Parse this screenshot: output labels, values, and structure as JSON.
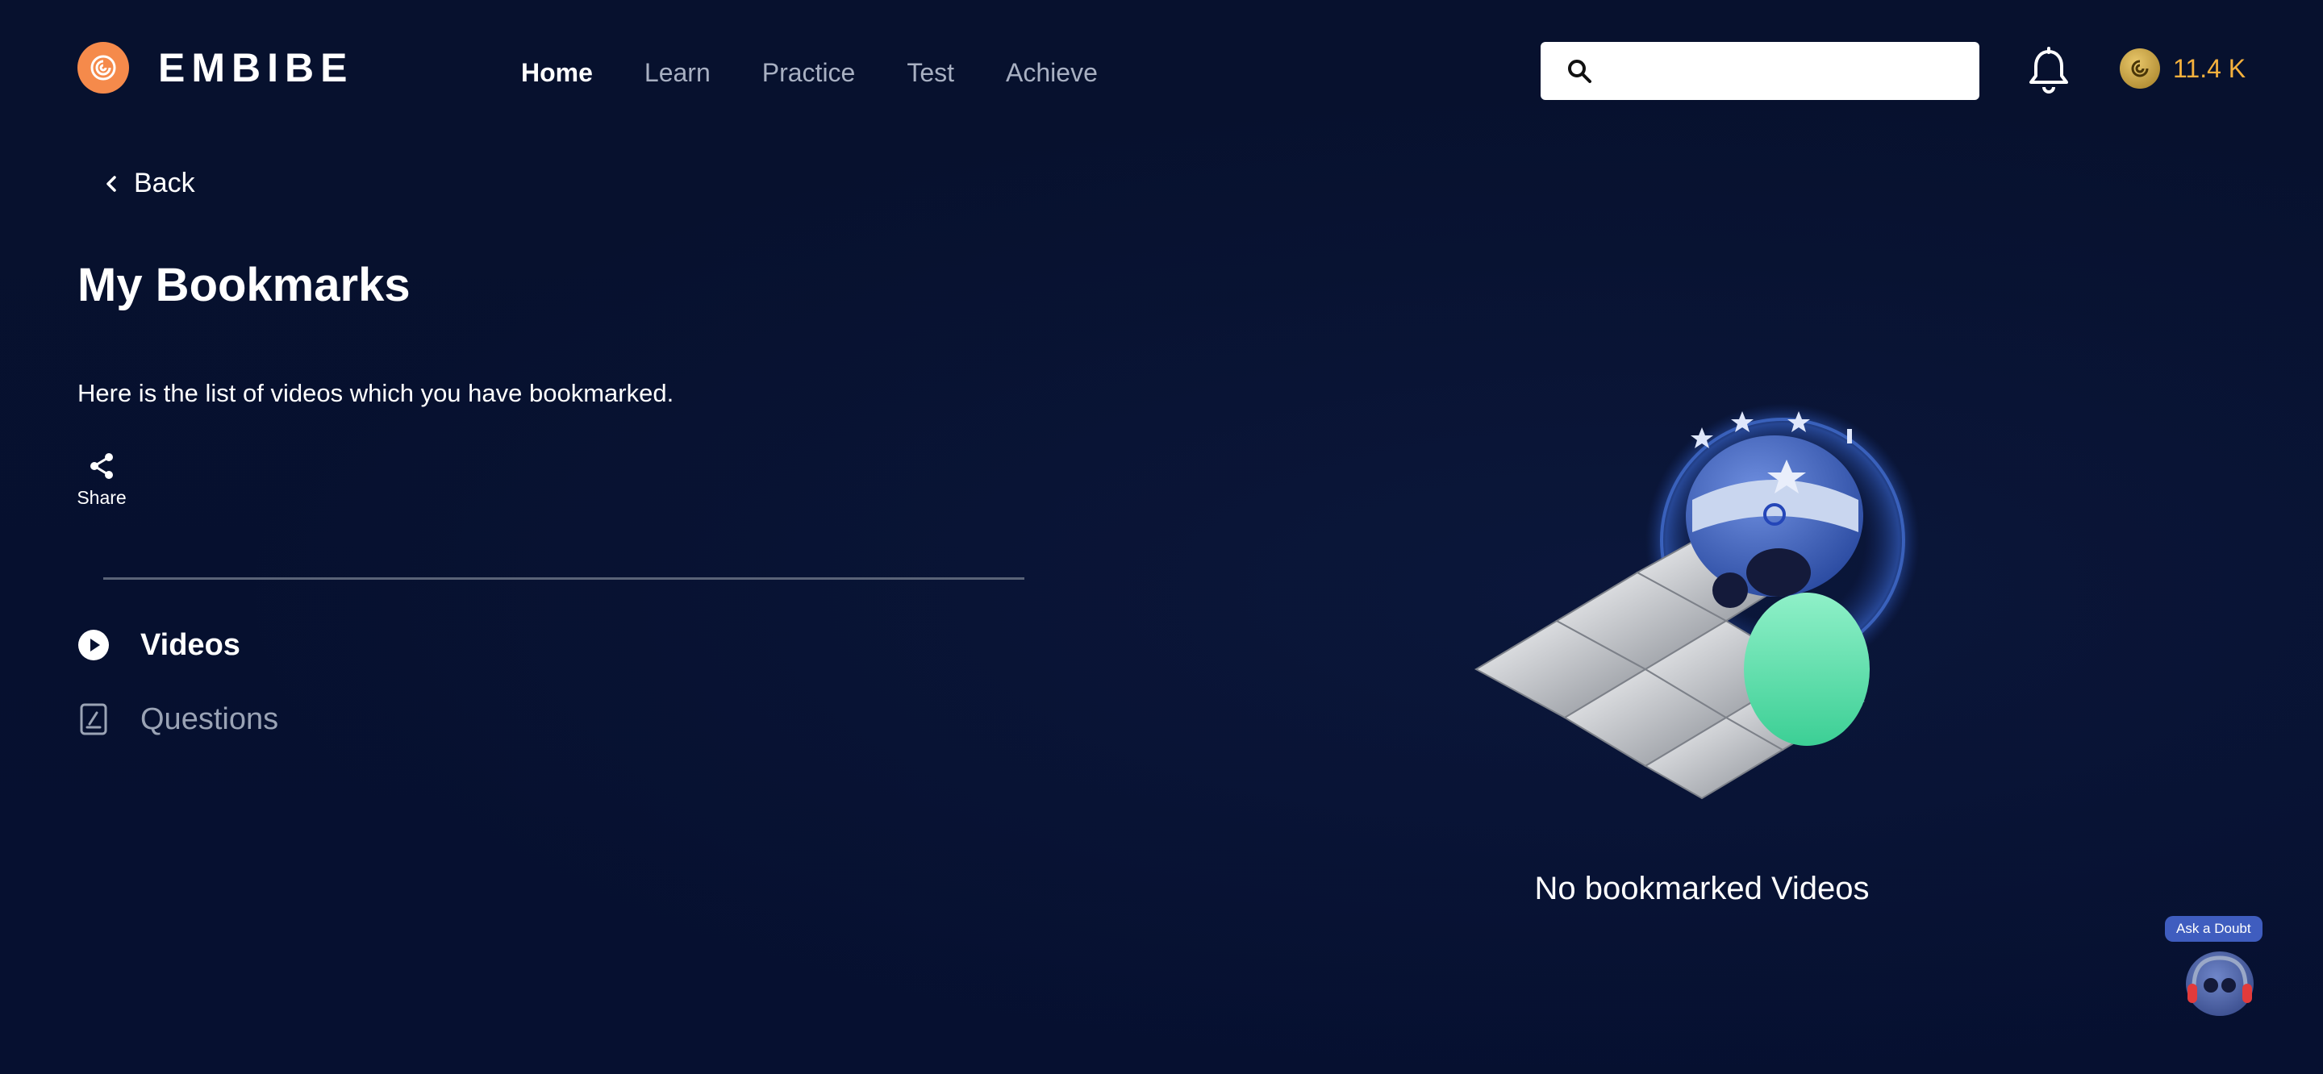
{
  "header": {
    "brand": "EMBIBE",
    "nav": [
      {
        "label": "Home",
        "active": true
      },
      {
        "label": "Learn",
        "active": false
      },
      {
        "label": "Practice",
        "active": false
      },
      {
        "label": "Test",
        "active": false
      },
      {
        "label": "Achieve",
        "active": false
      }
    ],
    "search": {
      "placeholder": "",
      "value": ""
    },
    "coins": "11.4 K"
  },
  "page": {
    "back_label": "Back",
    "title": "My Bookmarks",
    "subtitle": "Here is the list of videos which you have bookmarked.",
    "share_label": "Share"
  },
  "tabs": [
    {
      "label": "Videos",
      "icon": "play-circle-icon",
      "active": true
    },
    {
      "label": "Questions",
      "icon": "question-sheet-icon",
      "active": false
    }
  ],
  "empty_state": {
    "message": "No bookmarked Videos"
  },
  "doubt": {
    "label": "Ask a Doubt"
  },
  "colors": {
    "background": "#061130",
    "brand_orange": "#f58a4b",
    "coin_text": "#f5b13d",
    "inactive_text": "#9aa3b5",
    "divider": "#5a6377"
  }
}
